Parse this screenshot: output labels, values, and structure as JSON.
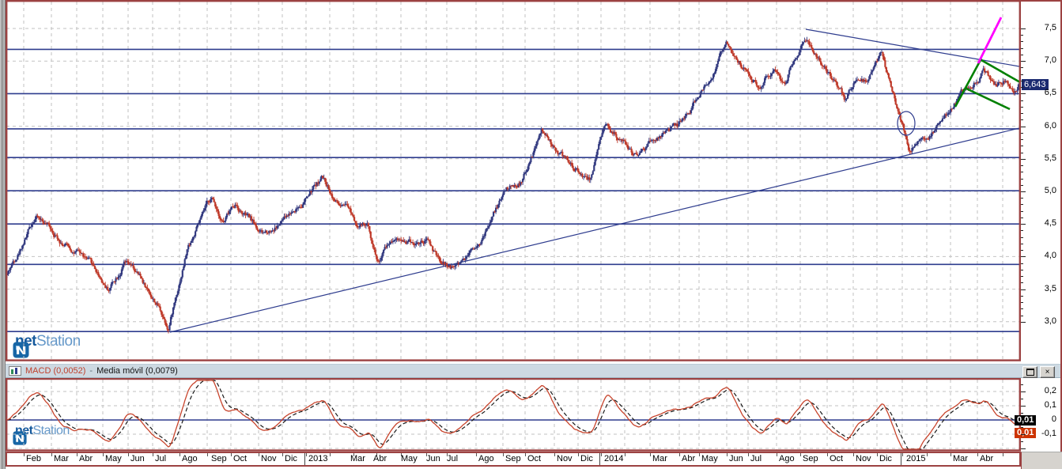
{
  "colors": {
    "frame": "#9c4242",
    "grid_dash": "#c2c2c2",
    "navy": "#2e3c8e",
    "candle_up": "#333a80",
    "candle_down": "#bf3a2a",
    "green": "#008000",
    "magenta": "#ff00ff",
    "macd_line": "#c8442c",
    "signal_line": "#1a1a1a",
    "header_bg": "#cdd9e2",
    "tag_bg": "#1b2a70",
    "box_black": "#000000",
    "box_red": "#cc3300"
  },
  "price_panel": {
    "y_axis_labels": [
      "7,5",
      "7,0",
      "6,5",
      "6,0",
      "5,5",
      "5,0",
      "4,5",
      "4,0",
      "3,5",
      "3,0"
    ],
    "y_axis_values": [
      7.5,
      7.0,
      6.5,
      6.0,
      5.5,
      5.0,
      4.5,
      4.0,
      3.5,
      3.0
    ],
    "last_price_label": "6,643",
    "last_price": 6.643
  },
  "macd_panel": {
    "macd_label": "MACD (0,0052)",
    "separator": "-",
    "signal_label": "Media móvil (0,0079)",
    "macd_value": 0.0052,
    "signal_value": 0.0079,
    "y_axis_labels": [
      "0,2",
      "0,1",
      "0",
      "-0,1"
    ],
    "y_axis_values": [
      0.2,
      0.1,
      0,
      -0.1
    ],
    "value_boxes": [
      {
        "text": "0,01",
        "style": "black"
      },
      {
        "text": "0,01",
        "style": "red"
      }
    ],
    "maximize_glyph": "",
    "close_glyph": "×"
  },
  "watermark": {
    "bold": "net",
    "light": "Station"
  },
  "x_axis": {
    "labels": [
      {
        "t": "Feb",
        "x": 33
      },
      {
        "t": "Mar",
        "x": 68
      },
      {
        "t": "Abr",
        "x": 100
      },
      {
        "t": "May",
        "x": 133
      },
      {
        "t": "Jun",
        "x": 165
      },
      {
        "t": "Jul",
        "x": 196
      },
      {
        "t": "Ago",
        "x": 230
      },
      {
        "t": "Sep",
        "x": 267
      },
      {
        "t": "Oct",
        "x": 295
      },
      {
        "t": "Nov",
        "x": 330
      },
      {
        "t": "Dic",
        "x": 360
      },
      {
        "t": "2013",
        "x": 390
      },
      {
        "t": "Mar",
        "x": 443
      },
      {
        "t": "Abr",
        "x": 472
      },
      {
        "t": "May",
        "x": 507
      },
      {
        "t": "Jun",
        "x": 539
      },
      {
        "t": "Jul",
        "x": 565
      },
      {
        "t": "Ago",
        "x": 605
      },
      {
        "t": "Sep",
        "x": 639
      },
      {
        "t": "Oct",
        "x": 667
      },
      {
        "t": "Nov",
        "x": 704
      },
      {
        "t": "Dic",
        "x": 734
      },
      {
        "t": "2014",
        "x": 764
      },
      {
        "t": "Mar",
        "x": 825
      },
      {
        "t": "Abr",
        "x": 862
      },
      {
        "t": "May",
        "x": 887
      },
      {
        "t": "Jun",
        "x": 922
      },
      {
        "t": "Jul",
        "x": 949
      },
      {
        "t": "Ago",
        "x": 985
      },
      {
        "t": "Sep",
        "x": 1015
      },
      {
        "t": "Oct",
        "x": 1049
      },
      {
        "t": "Nov",
        "x": 1082
      },
      {
        "t": "Dic",
        "x": 1112
      },
      {
        "t": "2015",
        "x": 1146
      },
      {
        "t": "Mar",
        "x": 1205
      },
      {
        "t": "Abr",
        "x": 1239
      }
    ],
    "year_separators": [
      385,
      758,
      1139
    ]
  },
  "chart_data": [
    {
      "type": "candlestick",
      "ylabel": "price",
      "ylim": [
        2.5,
        7.85
      ],
      "last": 6.643,
      "bars": 866,
      "seed": 42,
      "grid_price_values": [
        7.5,
        7.0,
        6.5,
        6.0,
        5.5,
        5.0,
        4.5,
        4.0,
        3.5,
        3.0
      ],
      "month_grid_x": [
        30,
        65,
        97,
        130,
        162,
        193,
        227,
        262,
        292,
        327,
        357,
        387,
        417,
        447,
        476,
        507,
        539,
        565,
        602,
        636,
        664,
        701,
        731,
        760,
        790,
        822,
        859,
        884,
        919,
        946,
        982,
        1012,
        1046,
        1079,
        1109,
        1141,
        1172,
        1202,
        1236,
        1268
      ],
      "horizontal_levels": [
        7.18,
        6.5,
        5.96,
        5.52,
        5.01,
        4.5,
        3.88,
        2.85
      ],
      "trendlines": [
        [
          215,
          420,
          1289,
          162
        ],
        [
          1019,
          37,
          1289,
          84
        ]
      ],
      "green_lines": [
        [
          1208,
          135,
          1241,
          74
        ],
        [
          1241,
          76,
          1290,
          104
        ],
        [
          1222,
          112,
          1277,
          138
        ]
      ],
      "magenta_line": [
        1237,
        80,
        1266,
        22
      ],
      "ellipse": {
        "cx": 1146,
        "cy": 156,
        "rx": 11,
        "ry": 15
      },
      "price_anchors": [
        [
          9,
          3.72
        ],
        [
          45,
          4.65
        ],
        [
          72,
          4.35
        ],
        [
          105,
          4.0
        ],
        [
          137,
          3.52
        ],
        [
          157,
          3.93
        ],
        [
          172,
          3.72
        ],
        [
          200,
          3.25
        ],
        [
          213,
          2.95
        ],
        [
          237,
          4.15
        ],
        [
          267,
          4.85
        ],
        [
          283,
          4.55
        ],
        [
          298,
          4.82
        ],
        [
          332,
          4.32
        ],
        [
          363,
          4.6
        ],
        [
          395,
          5.02
        ],
        [
          407,
          5.2
        ],
        [
          429,
          4.8
        ],
        [
          452,
          4.52
        ],
        [
          465,
          4.45
        ],
        [
          478,
          3.95
        ],
        [
          500,
          4.35
        ],
        [
          516,
          4.28
        ],
        [
          543,
          4.2
        ],
        [
          556,
          3.87
        ],
        [
          572,
          3.82
        ],
        [
          590,
          4.05
        ],
        [
          614,
          4.4
        ],
        [
          640,
          5.05
        ],
        [
          660,
          5.15
        ],
        [
          685,
          5.88
        ],
        [
          705,
          5.55
        ],
        [
          745,
          5.22
        ],
        [
          768,
          6.0
        ],
        [
          785,
          5.8
        ],
        [
          800,
          5.55
        ],
        [
          825,
          5.75
        ],
        [
          858,
          5.95
        ],
        [
          890,
          6.6
        ],
        [
          918,
          7.25
        ],
        [
          935,
          7.0
        ],
        [
          948,
          6.75
        ],
        [
          962,
          6.62
        ],
        [
          980,
          7.0
        ],
        [
          993,
          6.65
        ],
        [
          1005,
          7.1
        ],
        [
          1018,
          7.45
        ],
        [
          1032,
          7.2
        ],
        [
          1048,
          6.8
        ],
        [
          1070,
          6.37
        ],
        [
          1085,
          6.8
        ],
        [
          1098,
          6.7
        ],
        [
          1115,
          7.05
        ],
        [
          1130,
          6.5
        ],
        [
          1142,
          6.0
        ],
        [
          1150,
          5.55
        ],
        [
          1160,
          5.8
        ],
        [
          1175,
          5.95
        ],
        [
          1190,
          6.1
        ],
        [
          1205,
          6.3
        ],
        [
          1222,
          6.6
        ],
        [
          1235,
          6.8
        ],
        [
          1243,
          6.9
        ],
        [
          1252,
          6.75
        ],
        [
          1262,
          6.6
        ],
        [
          1270,
          6.72
        ],
        [
          1280,
          6.6
        ],
        [
          1288,
          6.643
        ]
      ]
    },
    {
      "type": "line",
      "ylabel": "MACD",
      "ylim": [
        -0.27,
        0.28
      ],
      "zero_line": 0,
      "grid_values": [
        0.2,
        0.1,
        -0.1,
        -0.2
      ],
      "series": [
        {
          "name": "MACD",
          "style": "solid",
          "last": 0.0052
        },
        {
          "name": "Media móvil",
          "style": "dashed",
          "last": 0.0079
        }
      ],
      "derived": "EMA12-EMA26 of generated closes; signal EMA9"
    }
  ]
}
